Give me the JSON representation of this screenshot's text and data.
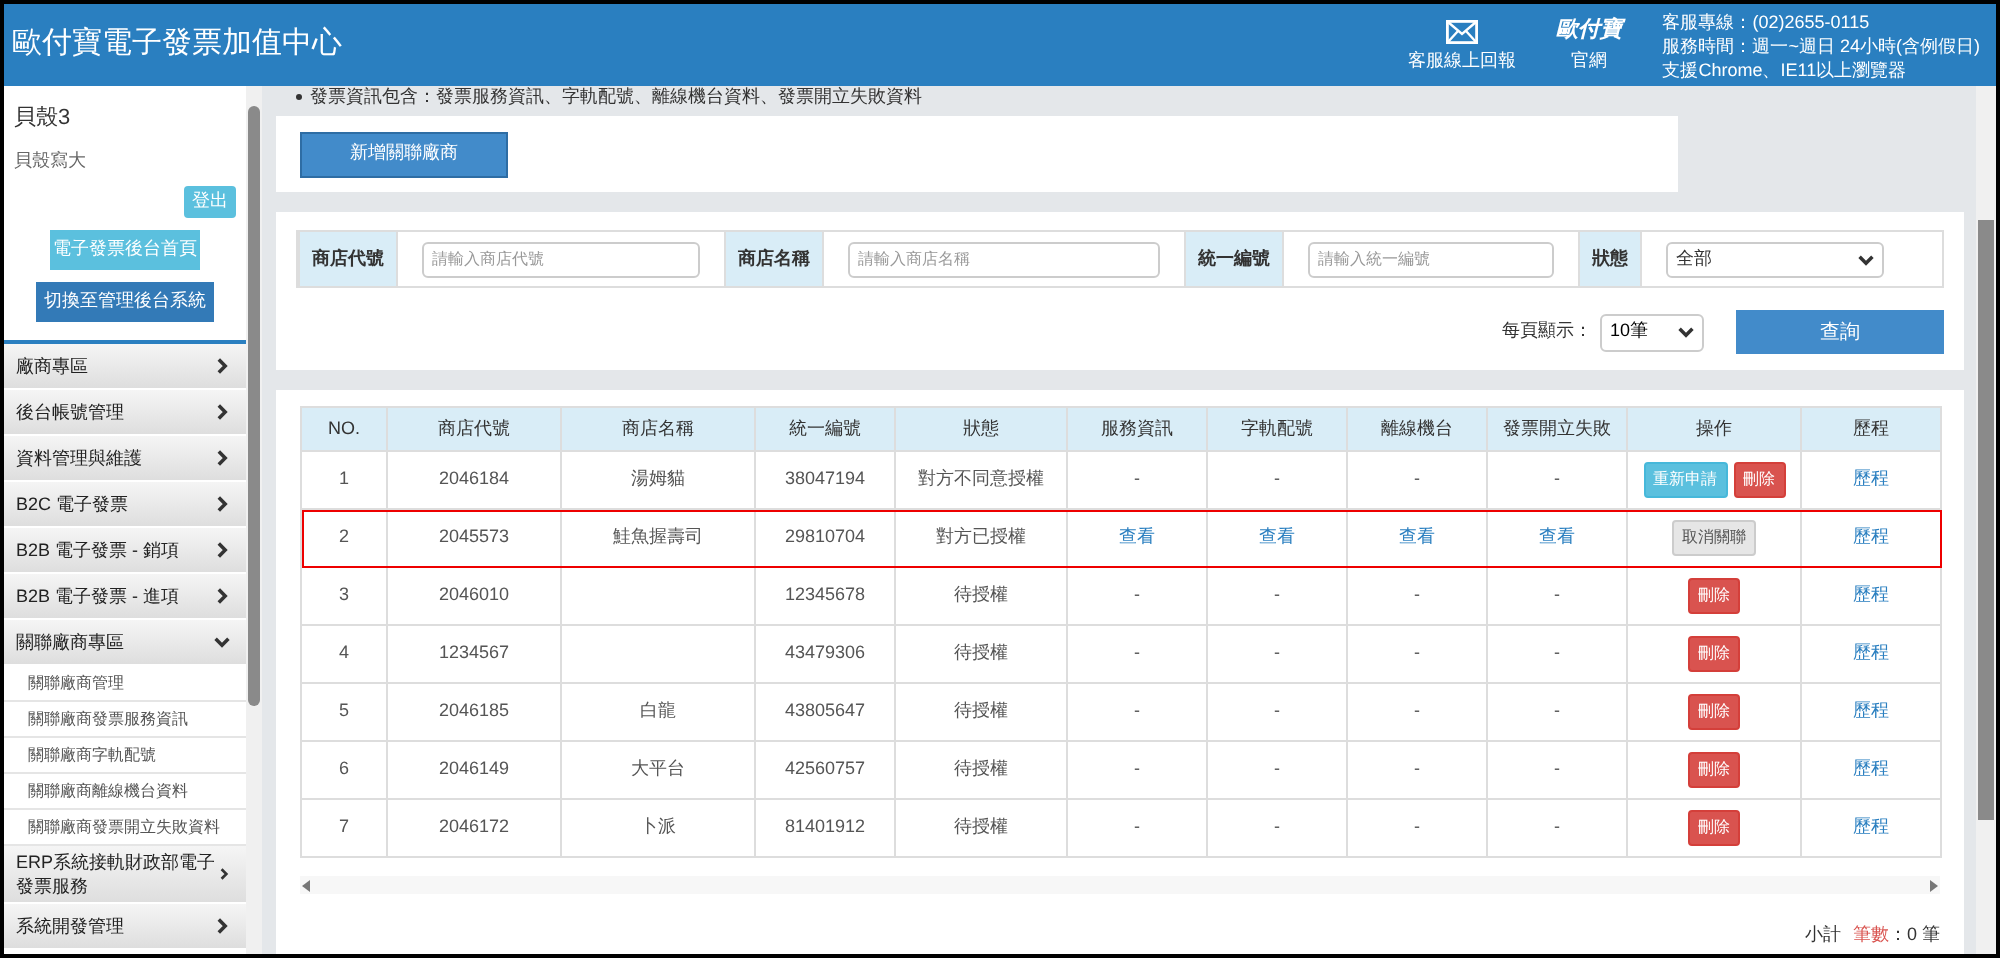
{
  "header": {
    "title": "歐付寶電子發票加值中心",
    "links": [
      {
        "kind": "mail",
        "label": "客服線上回報"
      },
      {
        "kind": "logo",
        "logo": "歐付寶",
        "label": "官網"
      }
    ],
    "info": [
      "客服專線：(02)2655-0115",
      "服務時間：週一~週日 24小時(含例假日)",
      "支援Chrome、IE11以上瀏覽器"
    ]
  },
  "sidebar": {
    "user_name": "貝殼3",
    "user_subtitle": "貝殼寫大",
    "logout_button": "登出",
    "home_button": "電子發票後台首頁",
    "switch_button": "切換至管理後台系統",
    "menu": [
      {
        "label": "廠商專區",
        "expanded": false
      },
      {
        "label": "後台帳號管理",
        "expanded": false
      },
      {
        "label": "資料管理與維護",
        "expanded": false
      },
      {
        "label": "B2C 電子發票",
        "expanded": false
      },
      {
        "label": "B2B 電子發票 - 銷項",
        "expanded": false
      },
      {
        "label": "B2B 電子發票 - 進項",
        "expanded": false
      },
      {
        "label": "關聯廠商專區",
        "expanded": true,
        "children": [
          {
            "label": "關聯廠商管理"
          },
          {
            "label": "關聯廠商發票服務資訊"
          },
          {
            "label": "關聯廠商字軌配號"
          },
          {
            "label": "關聯廠商離線機台資料"
          },
          {
            "label": "關聯廠商發票開立失敗資料"
          }
        ]
      },
      {
        "label": "ERP系統接軌財政部電子發票服務",
        "expanded": false
      },
      {
        "label": "系統開發管理",
        "expanded": false
      }
    ]
  },
  "notice": "發票資訊包含：發票服務資訊、字軌配號、離線機台資料、發票開立失敗資料",
  "add_button": "新增關聯廠商",
  "search": {
    "fields": [
      {
        "label": "商店代號",
        "kind": "text",
        "placeholder": "請輸入商店代號"
      },
      {
        "label": "商店名稱",
        "kind": "text",
        "placeholder": "請輸入商店名稱"
      },
      {
        "label": "統一編號",
        "kind": "text",
        "placeholder": "請輸入統一編號"
      },
      {
        "label": "狀態",
        "kind": "select",
        "value": "全部"
      }
    ],
    "page_size_label": "每頁顯示：",
    "page_size": "10筆",
    "submit": "查詢"
  },
  "table": {
    "columns": [
      "NO.",
      "商店代號",
      "商店名稱",
      "統一編號",
      "狀態",
      "服務資訊",
      "字軌配號",
      "離線機台",
      "發票開立失敗",
      "操作",
      "歷程"
    ],
    "rows": [
      {
        "selected": false,
        "cells": [
          {
            "kind": "text",
            "text": "1"
          },
          {
            "kind": "text",
            "text": "2046184"
          },
          {
            "kind": "text",
            "text": "湯姆貓"
          },
          {
            "kind": "text",
            "text": "38047194"
          },
          {
            "kind": "text",
            "text": "對方不同意授權"
          },
          {
            "kind": "text",
            "text": "-"
          },
          {
            "kind": "text",
            "text": "-"
          },
          {
            "kind": "text",
            "text": "-"
          },
          {
            "kind": "text",
            "text": "-"
          }
        ],
        "actions": [
          {
            "kind": "reapply",
            "label": "重新申請"
          },
          {
            "kind": "delete",
            "label": "刪除"
          }
        ],
        "history": "歷程"
      },
      {
        "selected": true,
        "cells": [
          {
            "kind": "text",
            "text": "2"
          },
          {
            "kind": "text",
            "text": "2045573"
          },
          {
            "kind": "text",
            "text": "鮭魚握壽司"
          },
          {
            "kind": "text",
            "text": "29810704"
          },
          {
            "kind": "text",
            "text": "對方已授權"
          },
          {
            "kind": "link",
            "text": "查看"
          },
          {
            "kind": "link",
            "text": "查看"
          },
          {
            "kind": "link",
            "text": "查看"
          },
          {
            "kind": "link",
            "text": "查看"
          }
        ],
        "actions": [
          {
            "kind": "unlink",
            "label": "取消關聯"
          }
        ],
        "history": "歷程"
      },
      {
        "selected": false,
        "cells": [
          {
            "kind": "text",
            "text": "3"
          },
          {
            "kind": "text",
            "text": "2046010"
          },
          {
            "kind": "blank"
          },
          {
            "kind": "text",
            "text": "12345678"
          },
          {
            "kind": "text",
            "text": "待授權"
          },
          {
            "kind": "text",
            "text": "-"
          },
          {
            "kind": "text",
            "text": "-"
          },
          {
            "kind": "text",
            "text": "-"
          },
          {
            "kind": "text",
            "text": "-"
          }
        ],
        "actions": [
          {
            "kind": "delete",
            "label": "刪除"
          }
        ],
        "history": "歷程"
      },
      {
        "selected": false,
        "cells": [
          {
            "kind": "text",
            "text": "4"
          },
          {
            "kind": "text",
            "text": "1234567"
          },
          {
            "kind": "blank"
          },
          {
            "kind": "text",
            "text": "43479306"
          },
          {
            "kind": "text",
            "text": "待授權"
          },
          {
            "kind": "text",
            "text": "-"
          },
          {
            "kind": "text",
            "text": "-"
          },
          {
            "kind": "text",
            "text": "-"
          },
          {
            "kind": "text",
            "text": "-"
          }
        ],
        "actions": [
          {
            "kind": "delete",
            "label": "刪除"
          }
        ],
        "history": "歷程"
      },
      {
        "selected": false,
        "cells": [
          {
            "kind": "text",
            "text": "5"
          },
          {
            "kind": "text",
            "text": "2046185"
          },
          {
            "kind": "text",
            "text": "白龍"
          },
          {
            "kind": "text",
            "text": "43805647"
          },
          {
            "kind": "text",
            "text": "待授權"
          },
          {
            "kind": "text",
            "text": "-"
          },
          {
            "kind": "text",
            "text": "-"
          },
          {
            "kind": "text",
            "text": "-"
          },
          {
            "kind": "text",
            "text": "-"
          }
        ],
        "actions": [
          {
            "kind": "delete",
            "label": "刪除"
          }
        ],
        "history": "歷程"
      },
      {
        "selected": false,
        "cells": [
          {
            "kind": "text",
            "text": "6"
          },
          {
            "kind": "text",
            "text": "2046149"
          },
          {
            "kind": "text",
            "text": "大平台"
          },
          {
            "kind": "text",
            "text": "42560757"
          },
          {
            "kind": "text",
            "text": "待授權"
          },
          {
            "kind": "text",
            "text": "-"
          },
          {
            "kind": "text",
            "text": "-"
          },
          {
            "kind": "text",
            "text": "-"
          },
          {
            "kind": "text",
            "text": "-"
          }
        ],
        "actions": [
          {
            "kind": "delete",
            "label": "刪除"
          }
        ],
        "history": "歷程"
      },
      {
        "selected": false,
        "cells": [
          {
            "kind": "text",
            "text": "7"
          },
          {
            "kind": "text",
            "text": "2046172"
          },
          {
            "kind": "text",
            "text": "卜派"
          },
          {
            "kind": "text",
            "text": "81401912"
          },
          {
            "kind": "text",
            "text": "待授權"
          },
          {
            "kind": "text",
            "text": "-"
          },
          {
            "kind": "text",
            "text": "-"
          },
          {
            "kind": "text",
            "text": "-"
          },
          {
            "kind": "text",
            "text": "-"
          }
        ],
        "actions": [
          {
            "kind": "delete",
            "label": "刪除"
          }
        ],
        "history": "歷程"
      }
    ]
  },
  "footer": {
    "subtotal_label": "小計",
    "count_label": "筆數",
    "count": "：0 筆"
  }
}
